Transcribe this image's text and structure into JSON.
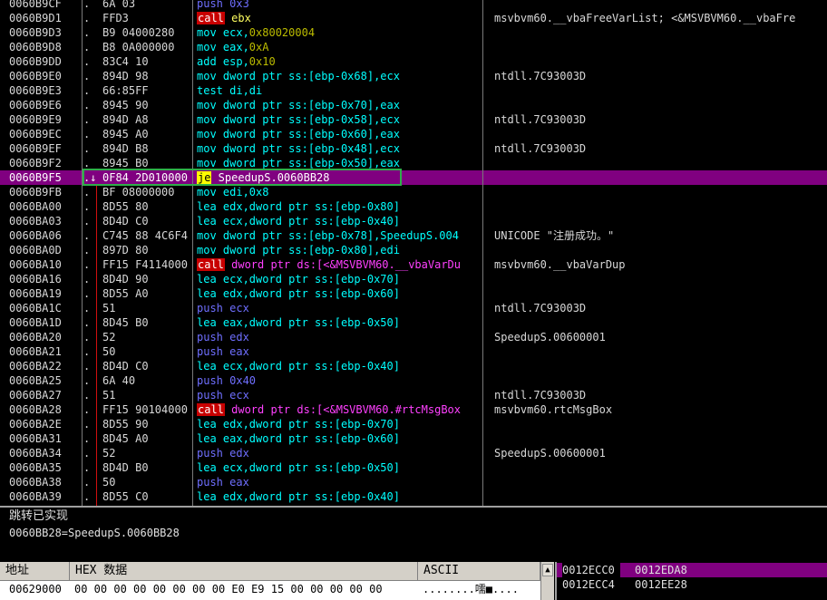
{
  "disasm": {
    "rows": [
      {
        "addr": "0060B9CF",
        "mark": ".",
        "hex": "6A 03",
        "asm": [
          {
            "t": "push ",
            "c": "t-pushc"
          },
          {
            "t": "0x3",
            "c": "t-pushc"
          }
        ],
        "cmt": ""
      },
      {
        "addr": "0060B9D1",
        "mark": ".",
        "hex": "FFD3",
        "asm": [
          {
            "t": "call",
            "c": "mnem-call"
          },
          {
            "t": " ebx",
            "c": "t-call"
          }
        ],
        "cmt": "msvbvm60.__vbaFreeVarList; <&MSVBVM60.__vbaFre"
      },
      {
        "addr": "0060B9D3",
        "mark": ".",
        "hex": "B9 04000280",
        "asm": [
          {
            "t": "mov ecx,",
            "c": "t-mov"
          },
          {
            "t": "0x80020004",
            "c": "t-num"
          }
        ],
        "cmt": ""
      },
      {
        "addr": "0060B9D8",
        "mark": ".",
        "hex": "B8 0A000000",
        "asm": [
          {
            "t": "mov eax,",
            "c": "t-mov"
          },
          {
            "t": "0xA",
            "c": "t-num"
          }
        ],
        "cmt": ""
      },
      {
        "addr": "0060B9DD",
        "mark": ".",
        "hex": "83C4 10",
        "asm": [
          {
            "t": "add esp,",
            "c": "t-mov"
          },
          {
            "t": "0x10",
            "c": "t-num"
          }
        ],
        "cmt": ""
      },
      {
        "addr": "0060B9E0",
        "mark": ".",
        "hex": "894D 98",
        "asm": [
          {
            "t": "mov dword ptr ss:[ebp-0x68],ecx",
            "c": "t-mov"
          }
        ],
        "cmt": "ntdll.7C93003D"
      },
      {
        "addr": "0060B9E3",
        "mark": ".",
        "hex": "66:85FF",
        "asm": [
          {
            "t": "test di,di",
            "c": "t-mov"
          }
        ],
        "cmt": ""
      },
      {
        "addr": "0060B9E6",
        "mark": ".",
        "hex": "8945 90",
        "asm": [
          {
            "t": "mov dword ptr ss:[ebp-0x70],eax",
            "c": "t-mov"
          }
        ],
        "cmt": ""
      },
      {
        "addr": "0060B9E9",
        "mark": ".",
        "hex": "894D A8",
        "asm": [
          {
            "t": "mov dword ptr ss:[ebp-0x58],ecx",
            "c": "t-mov"
          }
        ],
        "cmt": "ntdll.7C93003D"
      },
      {
        "addr": "0060B9EC",
        "mark": ".",
        "hex": "8945 A0",
        "asm": [
          {
            "t": "mov dword ptr ss:[ebp-0x60],eax",
            "c": "t-mov"
          }
        ],
        "cmt": ""
      },
      {
        "addr": "0060B9EF",
        "mark": ".",
        "hex": "894D B8",
        "asm": [
          {
            "t": "mov dword ptr ss:[ebp-0x48],ecx",
            "c": "t-mov"
          }
        ],
        "cmt": "ntdll.7C93003D"
      },
      {
        "addr": "0060B9F2",
        "mark": ".",
        "hex": "8945 B0",
        "asm": [
          {
            "t": "mov dword ptr ss:[ebp-0x50],eax",
            "c": "t-mov"
          }
        ],
        "cmt": ""
      },
      {
        "addr": "0060B9F5",
        "mark": ".↓",
        "hex": "0F84 2D010000",
        "asm": [
          {
            "t": "je",
            "c": "mnem-je"
          },
          {
            "t": " SpeedupS.0060BB28",
            "c": ""
          }
        ],
        "cmt": "",
        "sel": true
      },
      {
        "addr": "0060B9FB",
        "mark": ".",
        "hex": "BF 08000000",
        "asm": [
          {
            "t": "mov edi,0x8",
            "c": "t-mov"
          }
        ],
        "cmt": ""
      },
      {
        "addr": "0060BA00",
        "mark": ".",
        "hex": "8D55 80",
        "asm": [
          {
            "t": "lea edx,dword ptr ss:[ebp-0x80]",
            "c": "t-mov"
          }
        ],
        "cmt": ""
      },
      {
        "addr": "0060BA03",
        "mark": ".",
        "hex": "8D4D C0",
        "asm": [
          {
            "t": "lea ecx,dword ptr ss:[ebp-0x40]",
            "c": "t-mov"
          }
        ],
        "cmt": ""
      },
      {
        "addr": "0060BA06",
        "mark": ".",
        "hex": "C745 88 4C6F4",
        "asm": [
          {
            "t": "mov dword ptr ss:[ebp-0x78],SpeedupS.004",
            "c": "t-mov"
          }
        ],
        "cmt": "UNICODE \"注册成功。\""
      },
      {
        "addr": "0060BA0D",
        "mark": ".",
        "hex": "897D 80",
        "asm": [
          {
            "t": "mov dword ptr ss:[ebp-0x80],edi",
            "c": "t-mov"
          }
        ],
        "cmt": ""
      },
      {
        "addr": "0060BA10",
        "mark": ".",
        "hex": "FF15 F4114000",
        "asm": [
          {
            "t": "call",
            "c": "mnem-call"
          },
          {
            "t": " dword ptr ds:[<&MSVBVM60.__vbaVarDu",
            "c": "t-ind"
          }
        ],
        "cmt": "msvbvm60.__vbaVarDup"
      },
      {
        "addr": "0060BA16",
        "mark": ".",
        "hex": "8D4D 90",
        "asm": [
          {
            "t": "lea ecx,dword ptr ss:[ebp-0x70]",
            "c": "t-mov"
          }
        ],
        "cmt": ""
      },
      {
        "addr": "0060BA19",
        "mark": ".",
        "hex": "8D55 A0",
        "asm": [
          {
            "t": "lea edx,dword ptr ss:[ebp-0x60]",
            "c": "t-mov"
          }
        ],
        "cmt": ""
      },
      {
        "addr": "0060BA1C",
        "mark": ".",
        "hex": "51",
        "asm": [
          {
            "t": "push ecx",
            "c": "t-pushc"
          }
        ],
        "cmt": "ntdll.7C93003D"
      },
      {
        "addr": "0060BA1D",
        "mark": ".",
        "hex": "8D45 B0",
        "asm": [
          {
            "t": "lea eax,dword ptr ss:[ebp-0x50]",
            "c": "t-mov"
          }
        ],
        "cmt": ""
      },
      {
        "addr": "0060BA20",
        "mark": ".",
        "hex": "52",
        "asm": [
          {
            "t": "push edx",
            "c": "t-pushc"
          }
        ],
        "cmt": "SpeedupS.00600001"
      },
      {
        "addr": "0060BA21",
        "mark": ".",
        "hex": "50",
        "asm": [
          {
            "t": "push eax",
            "c": "t-pushc"
          }
        ],
        "cmt": ""
      },
      {
        "addr": "0060BA22",
        "mark": ".",
        "hex": "8D4D C0",
        "asm": [
          {
            "t": "lea ecx,dword ptr ss:[ebp-0x40]",
            "c": "t-mov"
          }
        ],
        "cmt": ""
      },
      {
        "addr": "0060BA25",
        "mark": ".",
        "hex": "6A 40",
        "asm": [
          {
            "t": "push 0x40",
            "c": "t-pushc"
          }
        ],
        "cmt": ""
      },
      {
        "addr": "0060BA27",
        "mark": ".",
        "hex": "51",
        "asm": [
          {
            "t": "push ecx",
            "c": "t-pushc"
          }
        ],
        "cmt": "ntdll.7C93003D"
      },
      {
        "addr": "0060BA28",
        "mark": ".",
        "hex": "FF15 90104000",
        "asm": [
          {
            "t": "call",
            "c": "mnem-call"
          },
          {
            "t": " dword ptr ds:[<&MSVBVM60.#rtcMsgBox",
            "c": "t-ind"
          }
        ],
        "cmt": "msvbvm60.rtcMsgBox"
      },
      {
        "addr": "0060BA2E",
        "mark": ".",
        "hex": "8D55 90",
        "asm": [
          {
            "t": "lea edx,dword ptr ss:[ebp-0x70]",
            "c": "t-mov"
          }
        ],
        "cmt": ""
      },
      {
        "addr": "0060BA31",
        "mark": ".",
        "hex": "8D45 A0",
        "asm": [
          {
            "t": "lea eax,dword ptr ss:[ebp-0x60]",
            "c": "t-mov"
          }
        ],
        "cmt": ""
      },
      {
        "addr": "0060BA34",
        "mark": ".",
        "hex": "52",
        "asm": [
          {
            "t": "push edx",
            "c": "t-pushc"
          }
        ],
        "cmt": "SpeedupS.00600001"
      },
      {
        "addr": "0060BA35",
        "mark": ".",
        "hex": "8D4D B0",
        "asm": [
          {
            "t": "lea ecx,dword ptr ss:[ebp-0x50]",
            "c": "t-mov"
          }
        ],
        "cmt": ""
      },
      {
        "addr": "0060BA38",
        "mark": ".",
        "hex": "50",
        "asm": [
          {
            "t": "push eax",
            "c": "t-pushc"
          }
        ],
        "cmt": ""
      },
      {
        "addr": "0060BA39",
        "mark": ".",
        "hex": "8D55 C0",
        "asm": [
          {
            "t": "lea edx,dword ptr ss:[ebp-0x40]",
            "c": "t-mov"
          }
        ],
        "cmt": ""
      }
    ]
  },
  "info": {
    "line1": "跳转已实现",
    "line2": "0060BB28=SpeedupS.0060BB28"
  },
  "dump": {
    "col_addr": "地址",
    "col_hex": "HEX 数据",
    "col_ascii": "ASCII",
    "row_addr": "00629000",
    "row_hex": "00 00 00 00 00 00 00 00 E0 E9 15 00 00 00 00 00",
    "row_ascii": "........嚅■...."
  },
  "stack": {
    "rows": [
      {
        "addr": "0012ECC0",
        "val": "0012EDA8",
        "sel": true
      },
      {
        "addr": "0012ECC4",
        "val": "0012EE28",
        "sel": false
      }
    ]
  },
  "colors": {
    "selection": "#800080",
    "mov": "#00ffff",
    "push": "#6f6fff",
    "call_bg": "#c80000",
    "je_bg": "#ffff00",
    "indirect": "#ff40ff",
    "number": "#bcbc00",
    "jump_box": "#2fae4a",
    "jump_line": "#d01010"
  }
}
